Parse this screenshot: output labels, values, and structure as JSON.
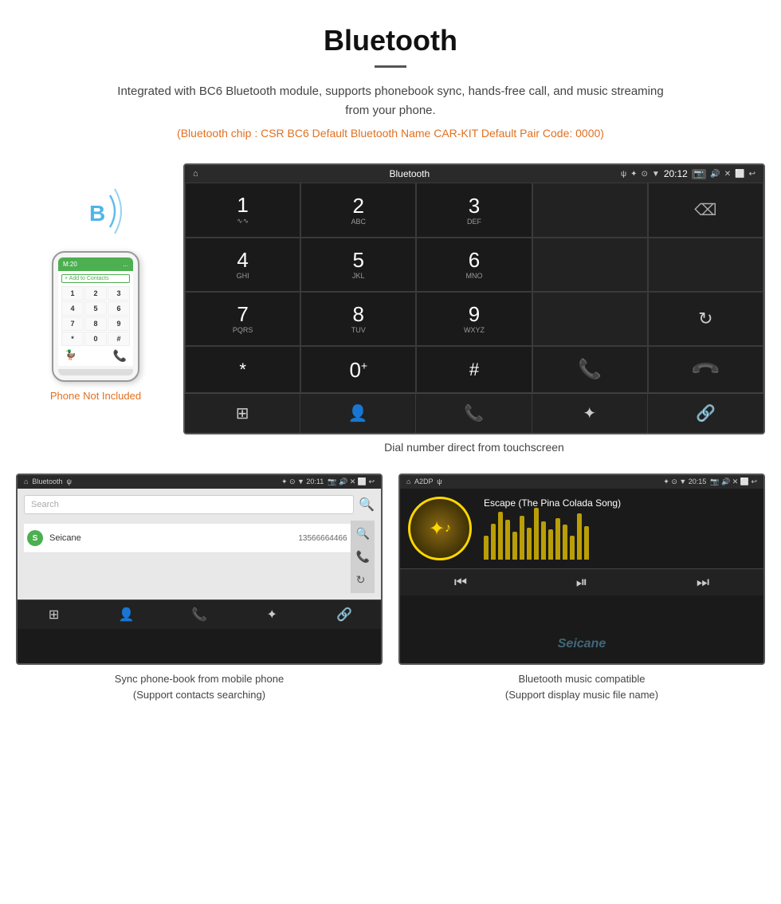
{
  "header": {
    "title": "Bluetooth",
    "description": "Integrated with BC6 Bluetooth module, supports phonebook sync, hands-free call, and music streaming from your phone.",
    "specs": "(Bluetooth chip : CSR BC6    Default Bluetooth Name CAR-KIT    Default Pair Code: 0000)"
  },
  "dial_screen": {
    "status_bar": {
      "left": "⌂",
      "center": "Bluetooth",
      "usb_icon": "ψ",
      "time": "20:12",
      "right_icons": "📷 🔊 ✕ ⬜ ↩"
    },
    "keys": [
      {
        "number": "1",
        "letters": "∿∿",
        "row": 0,
        "col": 0
      },
      {
        "number": "2",
        "letters": "ABC",
        "row": 0,
        "col": 1
      },
      {
        "number": "3",
        "letters": "DEF",
        "row": 0,
        "col": 2
      },
      {
        "number": "4",
        "letters": "GHI",
        "row": 1,
        "col": 0
      },
      {
        "number": "5",
        "letters": "JKL",
        "row": 1,
        "col": 1
      },
      {
        "number": "6",
        "letters": "MNO",
        "row": 1,
        "col": 2
      },
      {
        "number": "7",
        "letters": "PQRS",
        "row": 2,
        "col": 0
      },
      {
        "number": "8",
        "letters": "TUV",
        "row": 2,
        "col": 1
      },
      {
        "number": "9",
        "letters": "WXYZ",
        "row": 2,
        "col": 2
      },
      {
        "number": "*",
        "letters": "",
        "row": 3,
        "col": 0
      },
      {
        "number": "0",
        "letters": "+",
        "row": 3,
        "col": 1
      },
      {
        "number": "#",
        "letters": "",
        "row": 3,
        "col": 2
      }
    ],
    "caption": "Dial number direct from touchscreen"
  },
  "phonebook_screen": {
    "status_bar_left": "⌂  Bluetooth  ψ",
    "status_bar_right": "✦ ⊙ ▼ 20:11  📷 🔊 ✕ ⬜ ↩",
    "search_placeholder": "Search",
    "contact_letter": "S",
    "contact_name": "Seicane",
    "contact_number": "13566664466",
    "caption_line1": "Sync phone-book from mobile phone",
    "caption_line2": "(Support contacts searching)"
  },
  "music_screen": {
    "status_bar_left": "⌂  A2DP  ψ",
    "status_bar_right": "✦ ⊙ ▼ 20:15  📷 🔊 ✕ ⬜ ↩",
    "song_title": "Escape (The Pina Colada Song)",
    "caption_line1": "Bluetooth music compatible",
    "caption_line2": "(Support display music file name)"
  },
  "phone_section": {
    "not_included_label": "Phone Not Included"
  },
  "equalizer_bars": [
    30,
    45,
    60,
    50,
    35,
    55,
    40,
    65,
    48,
    38,
    52,
    44,
    30,
    58,
    42
  ]
}
